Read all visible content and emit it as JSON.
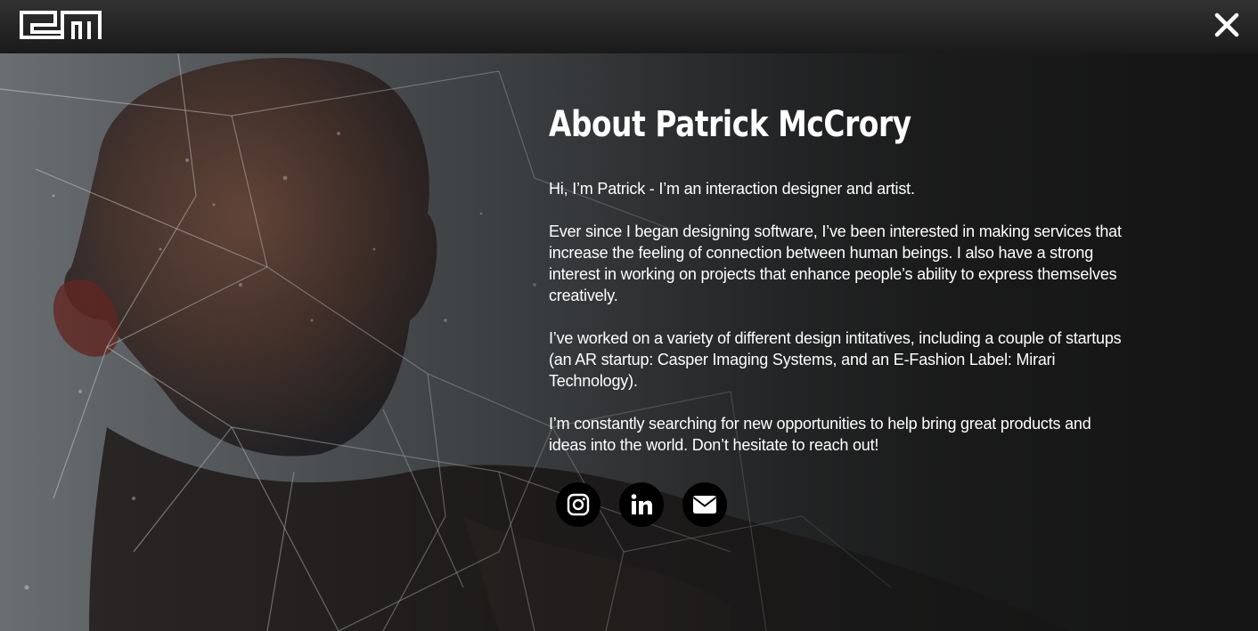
{
  "header": {
    "logo_name": "pm-logo",
    "close_icon": "close-icon"
  },
  "about": {
    "title": "About Patrick McCrory",
    "paragraphs": [
      "Hi, I’m Patrick - I’m an interaction designer and artist.",
      "Ever since I began designing software, I’ve been interested in making services that increase the feeling of connection between human beings. I also have a strong interest in working on projects that enhance people’s ability to express themselves creatively.",
      "I’ve worked on a variety of different design intitatives, including a couple of startups (an AR startup: Casper Imaging Systems, and an E-Fashion Label: Mirari Technology).",
      "I’m constantly searching for new opportunities to help bring great products and ideas into the world. Don’t hesitate to reach out!"
    ]
  },
  "socials": [
    {
      "icon": "instagram-icon"
    },
    {
      "icon": "linkedin-icon"
    },
    {
      "icon": "email-icon"
    }
  ],
  "colors": {
    "topbar": "#2a2a2a",
    "background": "#1c1c1c",
    "text": "#ffffff",
    "social_bg": "#000000"
  }
}
